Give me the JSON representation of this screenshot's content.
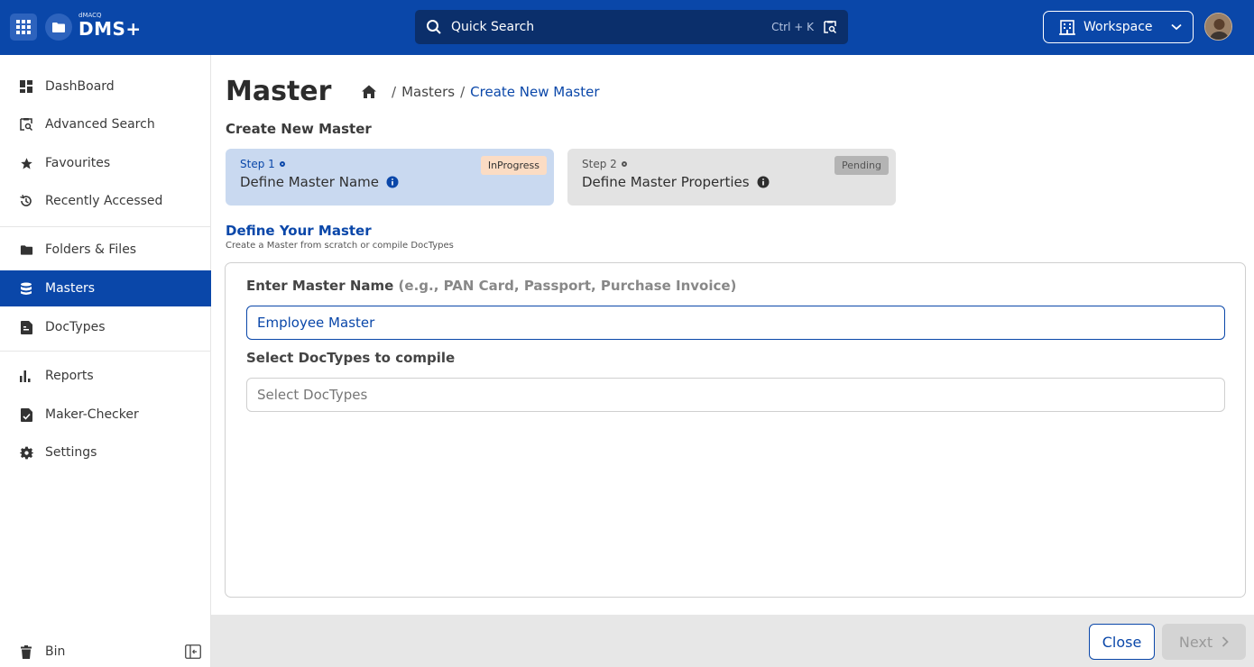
{
  "header": {
    "logo_small": "dMACQ",
    "logo_main": "DMS+",
    "search_label": "Quick Search",
    "search_shortcut": "Ctrl + K",
    "workspace_label": "Workspace"
  },
  "sidebar": {
    "items": [
      {
        "label": "DashBoard",
        "icon": "dashboard-icon"
      },
      {
        "label": "Advanced Search",
        "icon": "advanced-search-icon"
      },
      {
        "label": "Favourites",
        "icon": "star-icon"
      },
      {
        "label": "Recently Accessed",
        "icon": "history-icon"
      },
      {
        "label": "Folders & Files",
        "icon": "folder-icon"
      },
      {
        "label": "Masters",
        "icon": "database-icon",
        "active": true
      },
      {
        "label": "DocTypes",
        "icon": "doctype-icon"
      },
      {
        "label": "Reports",
        "icon": "bar-chart-icon"
      },
      {
        "label": "Maker-Checker",
        "icon": "checker-icon"
      },
      {
        "label": "Settings",
        "icon": "gear-icon"
      }
    ],
    "bin_label": "Bin"
  },
  "page": {
    "title": "Master",
    "breadcrumb": {
      "sep1": "/",
      "masters": "Masters",
      "sep2": "/",
      "current": "Create New Master"
    },
    "sub_title": "Create New Master"
  },
  "steps": [
    {
      "label": "Step 1",
      "name": "Define Master Name",
      "status": "InProgress"
    },
    {
      "label": "Step 2",
      "name": "Define Master Properties",
      "status": "Pending"
    }
  ],
  "define": {
    "title": "Define Your Master",
    "subtitle": "Create a Master from scratch or compile DocTypes"
  },
  "form": {
    "name_label": "Enter Master Name",
    "name_hint": "(e.g., PAN Card, Passport, Purchase Invoice)",
    "name_value": "Employee Master",
    "doctypes_label": "Select DocTypes to compile",
    "doctypes_placeholder": "Select DocTypes"
  },
  "footer": {
    "close_label": "Close",
    "next_label": "Next"
  },
  "colors": {
    "brand": "#0a47a9",
    "step_active_bg": "#c9d9f0",
    "badge_progress": "#fbdcc4",
    "badge_pending": "#b4b4b4"
  }
}
